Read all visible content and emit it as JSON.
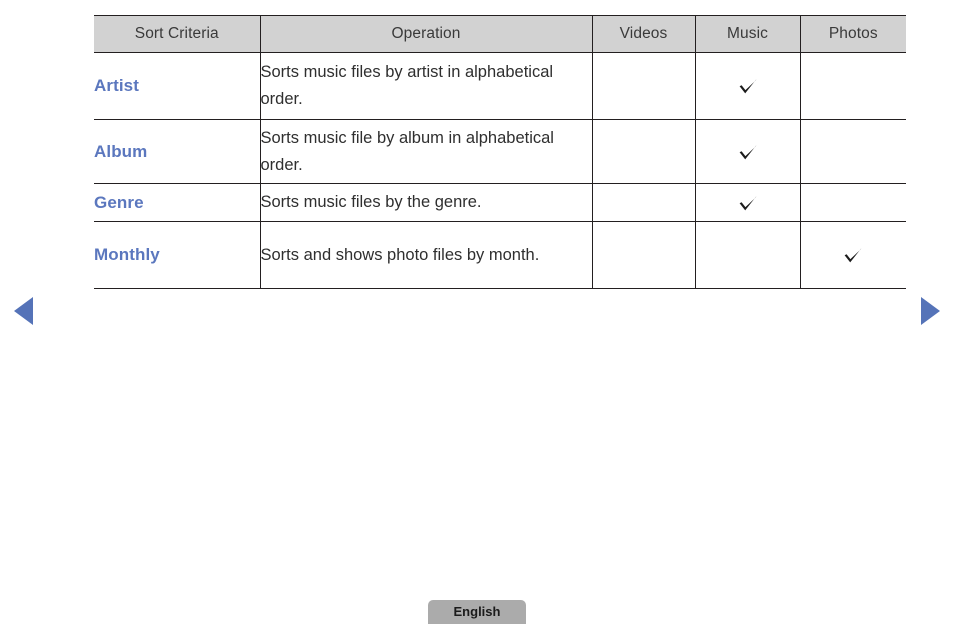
{
  "table": {
    "name": "sort-criteria-table",
    "columns": [
      {
        "key": "criteria",
        "label": "Sort Criteria"
      },
      {
        "key": "operation",
        "label": "Operation"
      },
      {
        "key": "videos",
        "label": "Videos"
      },
      {
        "key": "music",
        "label": "Music"
      },
      {
        "key": "photos",
        "label": "Photos"
      }
    ],
    "rows": [
      {
        "criteria": "Artist",
        "operation": "Sorts music files by artist in alphabetical order.",
        "videos": "",
        "music": "check",
        "photos": ""
      },
      {
        "criteria": "Album",
        "operation": "Sorts music file by album in alphabetical order.",
        "videos": "",
        "music": "check",
        "photos": ""
      },
      {
        "criteria": "Genre",
        "operation": "Sorts music files by the genre.",
        "videos": "",
        "music": "check",
        "photos": ""
      },
      {
        "criteria": "Monthly",
        "operation": "Sorts and shows photo files by month.",
        "videos": "",
        "music": "",
        "photos": "check"
      }
    ]
  },
  "navigation": {
    "previous_label": "◀",
    "next_label": "▶",
    "previous_icon": "triangle-left-icon",
    "next_icon": "triangle-right-icon"
  },
  "footer": {
    "language_label": "English"
  },
  "colors": {
    "link_blue": "#5b77be",
    "arrow_blue": "#5573b8",
    "header_gray": "#d2d2d2",
    "button_gray": "#ababab",
    "rule": "#231f20",
    "body_text": "#2f2f2f",
    "background": "#ffffff"
  }
}
